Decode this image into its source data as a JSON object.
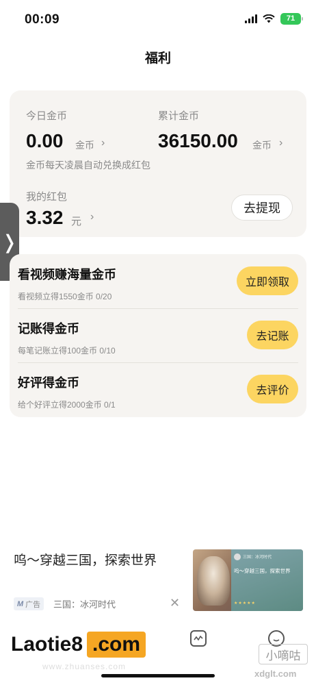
{
  "status_bar": {
    "time": "00:09",
    "battery": "71"
  },
  "page": {
    "title": "福利"
  },
  "coins": {
    "today_label": "今日金币",
    "today_value": "0.00",
    "today_unit": "金币",
    "total_label": "累计金币",
    "total_value": "36150.00",
    "total_unit": "金币",
    "note": "金币每天凌晨自动兑换成红包",
    "redpacket_label": "我的红包",
    "redpacket_value": "3.32",
    "redpacket_unit": "元",
    "withdraw_label": "去提现"
  },
  "tasks": [
    {
      "title": "看视频赚海量金币",
      "subtitle": "看视频立得1550金币 0/20",
      "button": "立即领取"
    },
    {
      "title": "记账得金币",
      "subtitle": "每笔记账立得100金币 0/10",
      "button": "去记账"
    },
    {
      "title": "好评得金币",
      "subtitle": "给个好评立得2000金币 0/1",
      "button": "去评价"
    }
  ],
  "ad": {
    "title": "呜～穿越三国，探索世界",
    "tag": "广告",
    "source": "三国：冰河时代",
    "image_name": "三国：冰河时代",
    "image_text": "呜～穿越三国，探索世界",
    "image_stars": "★★★★★"
  },
  "tabbar": {
    "icons": [
      "chart-icon",
      "profile-icon"
    ]
  },
  "watermark": {
    "left_main_1": "Laotie8",
    "left_main_2": ".com",
    "left_sub": "www.zhuanses.com",
    "right_box": "小嘀咕",
    "right_sub": "xdglt.com"
  }
}
